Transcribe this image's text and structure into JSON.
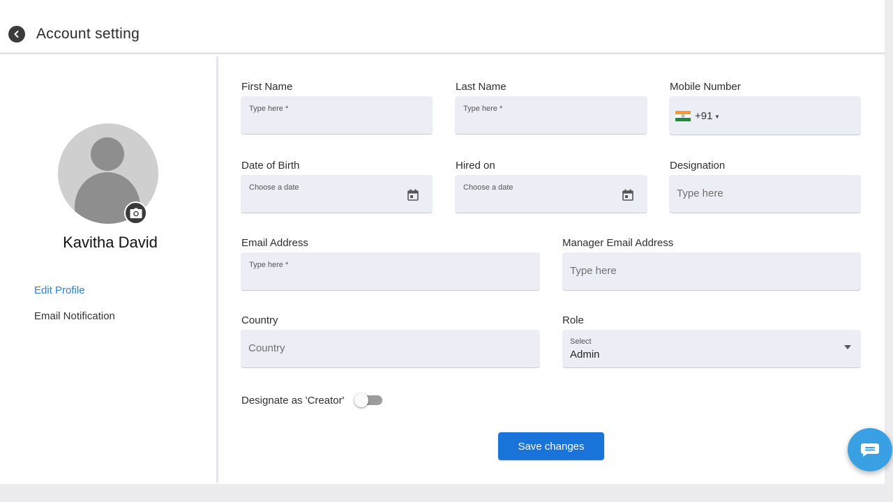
{
  "header": {
    "title": "Account setting"
  },
  "profile": {
    "name": "Kavitha David"
  },
  "sidebar": {
    "items": [
      {
        "label": "Edit Profile"
      },
      {
        "label": "Email Notification"
      }
    ]
  },
  "form": {
    "first_name": {
      "label": "First Name",
      "placeholder": "Type here *"
    },
    "last_name": {
      "label": "Last Name",
      "placeholder": "Type here *"
    },
    "mobile": {
      "label": "Mobile Number",
      "dial_code": "+91"
    },
    "dob": {
      "label": "Date of Birth",
      "placeholder": "Choose a date"
    },
    "hired_on": {
      "label": "Hired on",
      "placeholder": "Choose a date"
    },
    "designation": {
      "label": "Designation",
      "placeholder": "Type here"
    },
    "email": {
      "label": "Email Address",
      "placeholder": "Type here *"
    },
    "manager_email": {
      "label": "Manager Email Address",
      "placeholder": "Type here"
    },
    "country": {
      "label": "Country",
      "placeholder": "Country"
    },
    "role": {
      "label": "Role",
      "select_label": "Select",
      "value": "Admin"
    },
    "creator_toggle": {
      "label": "Designate as 'Creator'",
      "on": false
    },
    "save_label": "Save changes"
  },
  "colors": {
    "accent": "#1a73d9",
    "field_bg": "#eceef6",
    "chat": "#3aa0e4"
  }
}
